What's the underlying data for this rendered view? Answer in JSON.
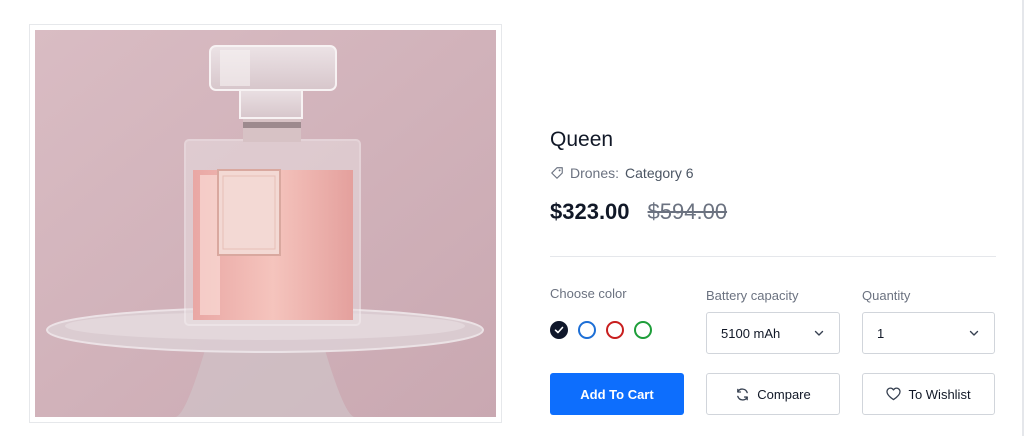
{
  "product": {
    "title": "Queen",
    "category_label": "Drones:",
    "category_name": "Category 6",
    "price": "$323.00",
    "old_price": "$594.00",
    "image_icon": "perfume-bottle-image"
  },
  "options": {
    "color_label": "Choose color",
    "colors": [
      {
        "name": "black",
        "hex": "#0f172a",
        "selected": true
      },
      {
        "name": "blue",
        "hex": "#1d6fd6",
        "selected": false
      },
      {
        "name": "red",
        "hex": "#c81e1e",
        "selected": false
      },
      {
        "name": "green",
        "hex": "#1e9e3a",
        "selected": false
      }
    ],
    "battery_label": "Battery capacity",
    "battery_value": "5100 mAh",
    "quantity_label": "Quantity",
    "quantity_value": "1"
  },
  "actions": {
    "add_to_cart": "Add To Cart",
    "compare": "Compare",
    "wishlist": "To Wishlist"
  }
}
